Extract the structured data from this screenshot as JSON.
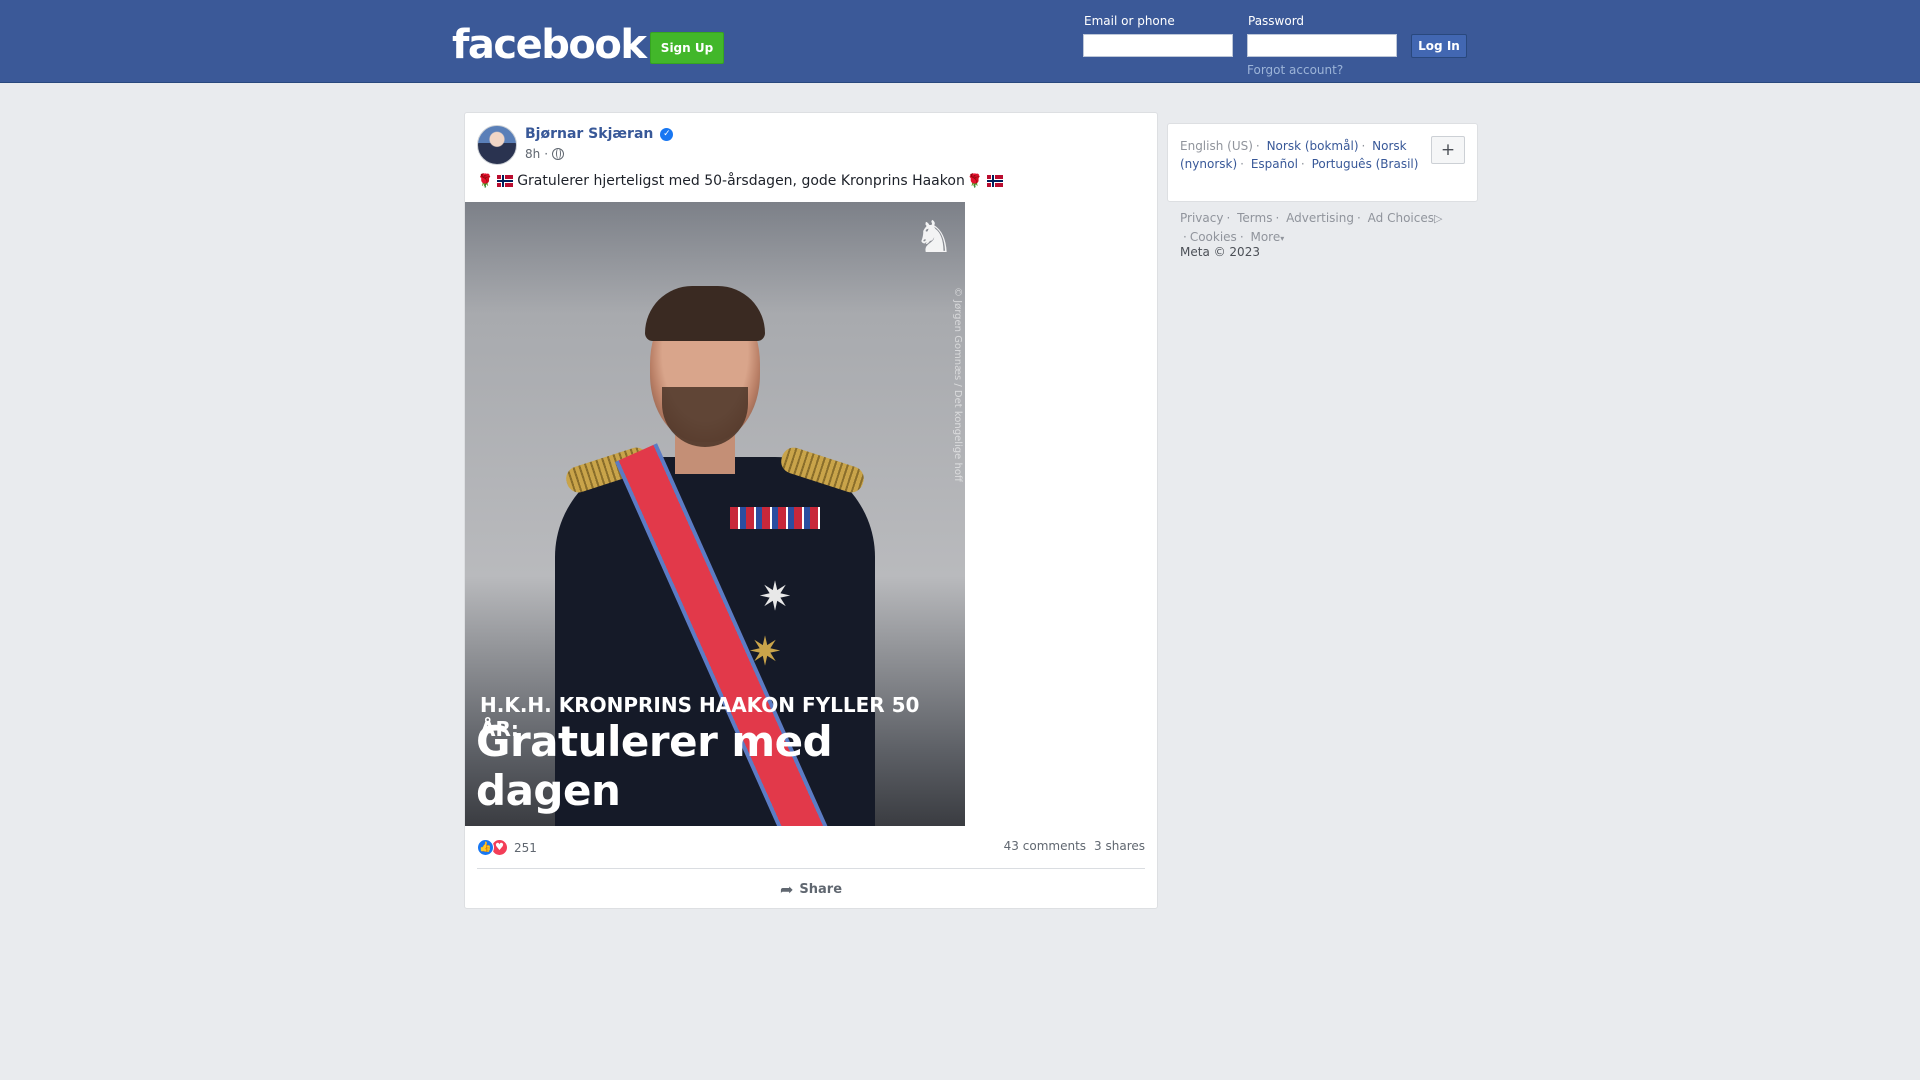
{
  "header": {
    "logo": "facebook",
    "signup_label": "Sign Up",
    "email_label": "Email or phone",
    "email_value": "",
    "password_label": "Password",
    "password_value": "",
    "login_label": "Log In",
    "forgot_label": "Forgot account?"
  },
  "post": {
    "author": "Bjørnar Skjæran",
    "verified": true,
    "time": "8h",
    "text": "Gratulerer hjerteligst med 50-årsdagen, gode Kronprins Haakon",
    "image": {
      "overlay_subtitle": "H.K.H. KRONPRINS HAAKON FYLLER 50 ÅR:",
      "overlay_title": "Gratulerer med dagen",
      "credit": "© Jørgen Gomnæs / Det kongelige hoff"
    },
    "reactions_count": "251",
    "comments": "43 comments",
    "shares": "3 shares",
    "share_label": "Share"
  },
  "languages": {
    "current": "English (US)",
    "others": [
      "Norsk (bokmål)",
      "Norsk (nynorsk)",
      "Español",
      "Português (Brasil)"
    ],
    "add_label": "+"
  },
  "footer": {
    "links": [
      "Privacy",
      "Terms",
      "Advertising",
      "Ad Choices",
      "Cookies",
      "More"
    ],
    "copyright": "Meta © 2023"
  },
  "colors": {
    "brand": "#3b5998",
    "signup": "#42b72a",
    "link": "#385898"
  },
  "icons": [
    "verified-badge-icon",
    "globe-icon",
    "like-reaction-icon",
    "love-reaction-icon",
    "share-arrow-icon",
    "ad-choices-icon",
    "plus-icon",
    "norway-lion-emblem-icon"
  ]
}
